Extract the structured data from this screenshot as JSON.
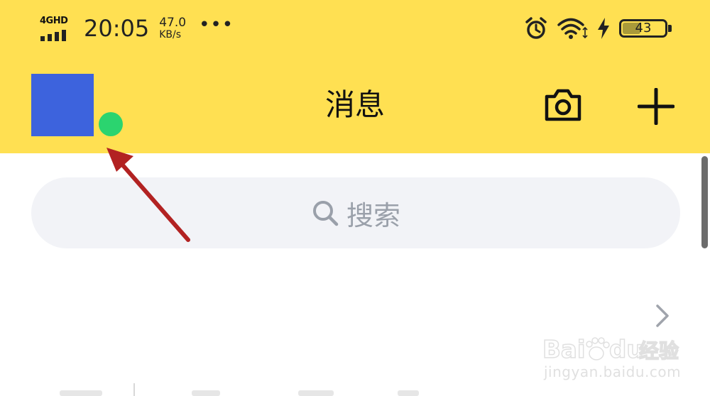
{
  "status_bar": {
    "network_type": "4GHD",
    "time": "20:05",
    "speed_value": "47.0",
    "speed_unit": "KB/s",
    "more": "•••",
    "battery_level": "43",
    "icons": [
      "signal-icon",
      "alarm-icon",
      "wifi-icon",
      "charging-icon",
      "battery-icon"
    ]
  },
  "header": {
    "title": "消息",
    "avatar_color": "#3D63DD",
    "online_status_color": "#2BD46F",
    "background": "#FFE052",
    "actions": [
      "camera-icon",
      "plus-icon"
    ]
  },
  "search": {
    "label": "搜索"
  },
  "annotation": {
    "arrow_color": "#B22222"
  },
  "watermark": {
    "brand": "Baidu经验",
    "url": "jingyan.baidu.com"
  }
}
